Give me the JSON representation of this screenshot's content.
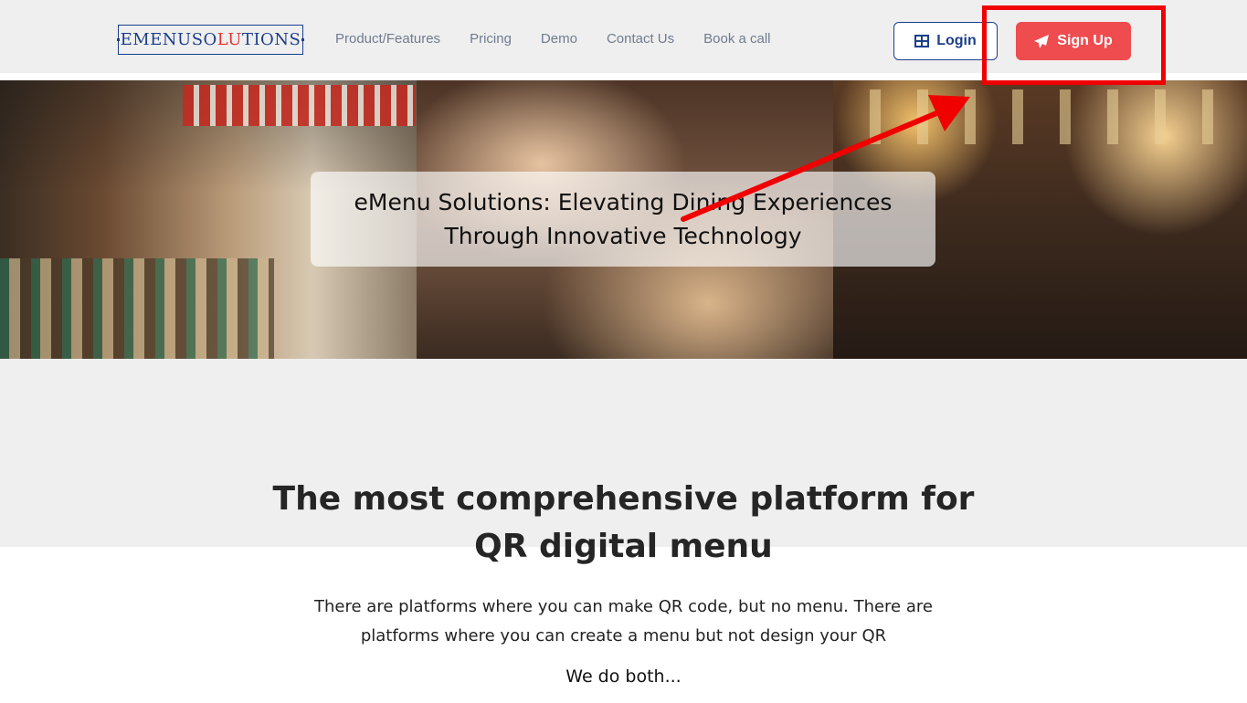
{
  "header": {
    "logo_prefix": "EMENUSO",
    "logo_accent": "LU",
    "logo_suffix": "TIONS",
    "nav": [
      "Product/Features",
      "Pricing",
      "Demo",
      "Contact Us",
      "Book a call"
    ],
    "login_label": "Login",
    "signup_label": "Sign Up"
  },
  "hero": {
    "caption_line1": "eMenu Solutions: Elevating Dining Experiences",
    "caption_line2": "Through Innovative Technology"
  },
  "main": {
    "headline_line1": "The most comprehensive platform for",
    "headline_line2": "QR digital menu",
    "desc_line1": "There are platforms where you can make QR code, but no menu. There are",
    "desc_line2": "platforms where you can create a menu but not design your QR",
    "both": "We do both..."
  },
  "icons": {
    "login": "grid-icon",
    "signup": "paper-plane-icon"
  },
  "colors": {
    "brand_blue": "#1c3f8a",
    "signup_red": "#ef4c4f",
    "annotation_red": "#f00000"
  }
}
